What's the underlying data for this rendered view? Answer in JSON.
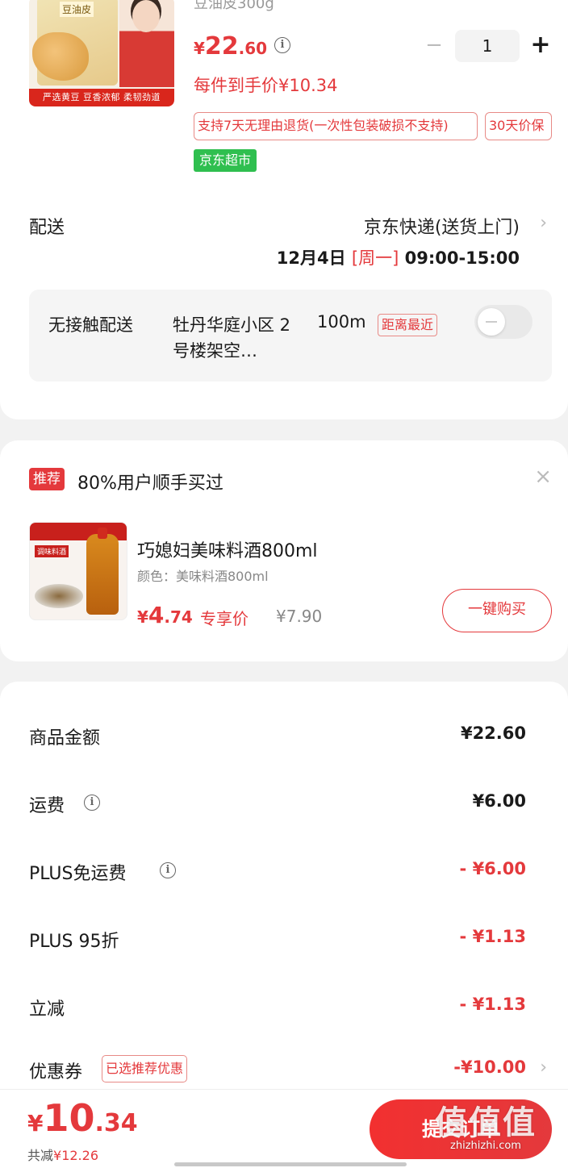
{
  "product": {
    "image_label": "豆油皮",
    "image_banner": "严选黄豆  豆香浓郁  柔韧劲道",
    "name_cut": "豆油皮300g",
    "price": {
      "yen": "¥",
      "int": "22",
      "dec": ".60"
    },
    "info_icon": "i",
    "per_item_price": "每件到手价¥10.34",
    "quantity": "1",
    "minus": "−",
    "plus": "+",
    "tags": {
      "return": "支持7天无理由退货(一次性包装破损不支持)",
      "price_protect": "30天价保",
      "store": "京东超市"
    }
  },
  "shipping": {
    "label": "配送",
    "method": "京东快递(送货上门)",
    "date": "12月4日",
    "weekday": "[周一]",
    "time": "09:00-15:00",
    "chevron": "›"
  },
  "no_contact": {
    "label": "无接触配送",
    "address": "牡丹华庭小区 2号楼架空…",
    "distance": "100m",
    "tag": "距离最近",
    "enabled": false
  },
  "recommend": {
    "badge": "推荐",
    "title": "80%用户顺手买过",
    "close": "×",
    "item": {
      "name": "巧媳妇美味料酒800ml",
      "variant": "颜色：美味料酒800ml",
      "price": {
        "yen": "¥",
        "int": "4",
        "dec": ".74"
      },
      "exclusive": "专享价",
      "original": "¥7.90",
      "image_label": "调味料酒",
      "buy_button": "一键购买"
    }
  },
  "summary": {
    "rows": [
      {
        "label": "商品金额",
        "value": "¥22.60"
      },
      {
        "label": "运费",
        "value": "¥6.00"
      },
      {
        "label": "PLUS免运费",
        "value": "- ¥6.00"
      },
      {
        "label": "PLUS 95折",
        "value": "- ¥1.13"
      },
      {
        "label": "立减",
        "value": "- ¥1.13"
      },
      {
        "label": "优惠券",
        "value": "-¥10.00",
        "tag": "已选推荐优惠"
      }
    ]
  },
  "bottom": {
    "total": {
      "yen": "¥",
      "int": "10",
      "dec": ".34"
    },
    "saved_label": "共减",
    "saved_value": "¥12.26",
    "submit": "提交订单",
    "watermark_logo": "值值值",
    "watermark_url": "zhizhizhi.com"
  },
  "colors": {
    "accent": "#e4393c",
    "green": "#2fbf4f"
  }
}
